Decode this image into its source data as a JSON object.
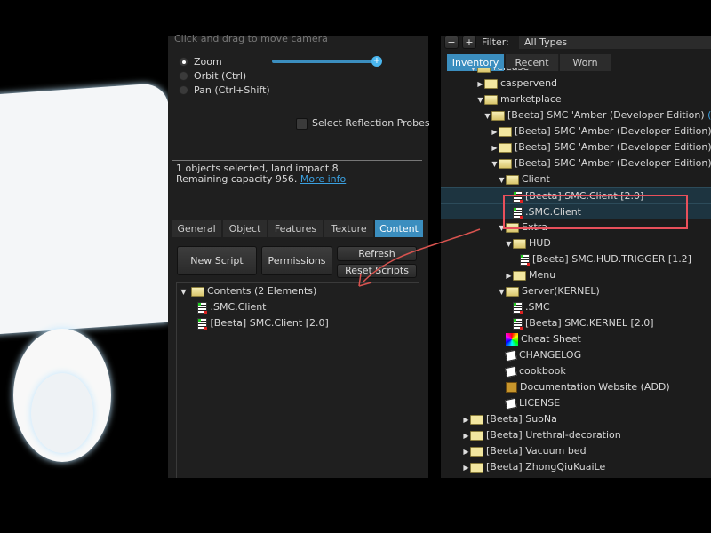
{
  "camera": {
    "hint": "Click and drag to move camera",
    "modes": [
      {
        "label": "Zoom",
        "selected": true
      },
      {
        "label": "Orbit (Ctrl)",
        "selected": false
      },
      {
        "label": "Pan (Ctrl+Shift)",
        "selected": false
      }
    ],
    "zoom_slider": 1.0,
    "reflection_probes_label": "Select Reflection Probes",
    "reflection_probes_checked": false
  },
  "selection": {
    "line1": "1 objects selected, land impact 8",
    "line2": "Remaining capacity 956.",
    "more_info": "More info"
  },
  "tabs": [
    "General",
    "Object",
    "Features",
    "Texture",
    "Content"
  ],
  "active_tab": "Content",
  "buttons": {
    "new_script": "New Script",
    "permissions": "Permissions",
    "refresh": "Refresh",
    "reset_scripts": "Reset Scripts"
  },
  "contents": {
    "folder": "Contents (2 Elements)",
    "items": [
      ".SMC.Client",
      "[Beeta] SMC.Client [2.0]"
    ]
  },
  "inventory": {
    "filter_label": "Filter:",
    "filter_value": "All Types",
    "minus": "−",
    "plus": "+",
    "tabs": [
      "Inventory",
      "Recent",
      "Worn"
    ],
    "active_tab": "Inventory",
    "items": [
      {
        "label": "release",
        "level": 1,
        "type": "folder",
        "expanded": true
      },
      {
        "label": "caspervend",
        "level": 2,
        "type": "folder",
        "expanded": false
      },
      {
        "label": "marketplace",
        "level": 2,
        "type": "folder",
        "expanded": true
      },
      {
        "label": "[Beeta] SMC 'Amber (Developer Edition)",
        "suffix": " (p",
        "level": 3,
        "type": "folder",
        "expanded": true
      },
      {
        "label": "[Beeta] SMC 'Amber (Developer Edition) [",
        "level": 4,
        "type": "folder",
        "expanded": false
      },
      {
        "label": "[Beeta] SMC 'Amber (Developer Edition) [",
        "level": 4,
        "type": "folder",
        "expanded": false
      },
      {
        "label": "[Beeta] SMC 'Amber (Developer Edition) [",
        "level": 4,
        "type": "folder",
        "expanded": true
      },
      {
        "label": "Client",
        "level": 5,
        "type": "folder",
        "expanded": true
      },
      {
        "label": "[Beeta] SMC.Client [2.0]",
        "level": 6,
        "type": "script",
        "selected": true
      },
      {
        "label": ".SMC.Client",
        "level": 6,
        "type": "script",
        "selected": true
      },
      {
        "label": "Extra",
        "level": 5,
        "type": "folder",
        "expanded": true
      },
      {
        "label": "HUD",
        "level": 6,
        "type": "folder",
        "expanded": true
      },
      {
        "label": "[Beeta] SMC.HUD.TRIGGER [1.2]",
        "level": 7,
        "type": "script"
      },
      {
        "label": "Menu",
        "level": 6,
        "type": "folder",
        "expanded": false
      },
      {
        "label": "Server(KERNEL)",
        "level": 5,
        "type": "folder",
        "expanded": true
      },
      {
        "label": ".SMC",
        "level": 6,
        "type": "script"
      },
      {
        "label": "[Beeta] SMC.KERNEL [2.0]",
        "level": 6,
        "type": "script"
      },
      {
        "label": "Cheat Sheet",
        "level": 5,
        "type": "texture"
      },
      {
        "label": "CHANGELOG",
        "level": 5,
        "type": "notecard"
      },
      {
        "label": "cookbook",
        "level": 5,
        "type": "notecard"
      },
      {
        "label": "Documentation Website (ADD)",
        "level": 5,
        "type": "object"
      },
      {
        "label": "LICENSE",
        "level": 5,
        "type": "notecard"
      },
      {
        "label": "[Beeta] SuoNa",
        "level": 0,
        "type": "folder",
        "expanded": false
      },
      {
        "label": "[Beeta] Urethral-decoration",
        "level": 0,
        "type": "folder",
        "expanded": false
      },
      {
        "label": "[Beeta] Vacuum bed",
        "level": 0,
        "type": "folder",
        "expanded": false
      },
      {
        "label": "[Beeta] ZhongQiuKuaiLe",
        "level": 0,
        "type": "folder",
        "expanded": false
      }
    ]
  },
  "colors": {
    "accent": "#3b8ebf",
    "highlight": "#e8505b",
    "link": "#3aa0e0"
  }
}
